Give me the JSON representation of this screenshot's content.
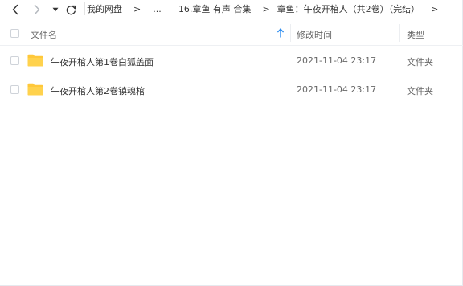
{
  "breadcrumb": {
    "items": [
      "我的网盘",
      "...",
      "16.章鱼 有声 合集",
      "章鱼：午夜开棺人（共2卷）（完结）"
    ],
    "separator": ">"
  },
  "header": {
    "name_label": "文件名",
    "modified_label": "修改时间",
    "type_label": "类型"
  },
  "files": [
    {
      "name": "午夜开棺人第1卷白狐盖面",
      "modified": "2021-11-04 23:17",
      "type": "文件夹"
    },
    {
      "name": "午夜开棺人第2卷镇魂棺",
      "modified": "2021-11-04 23:17",
      "type": "文件夹"
    }
  ],
  "colors": {
    "folder": "#ffcb3d",
    "accent": "#2b8cf0"
  }
}
